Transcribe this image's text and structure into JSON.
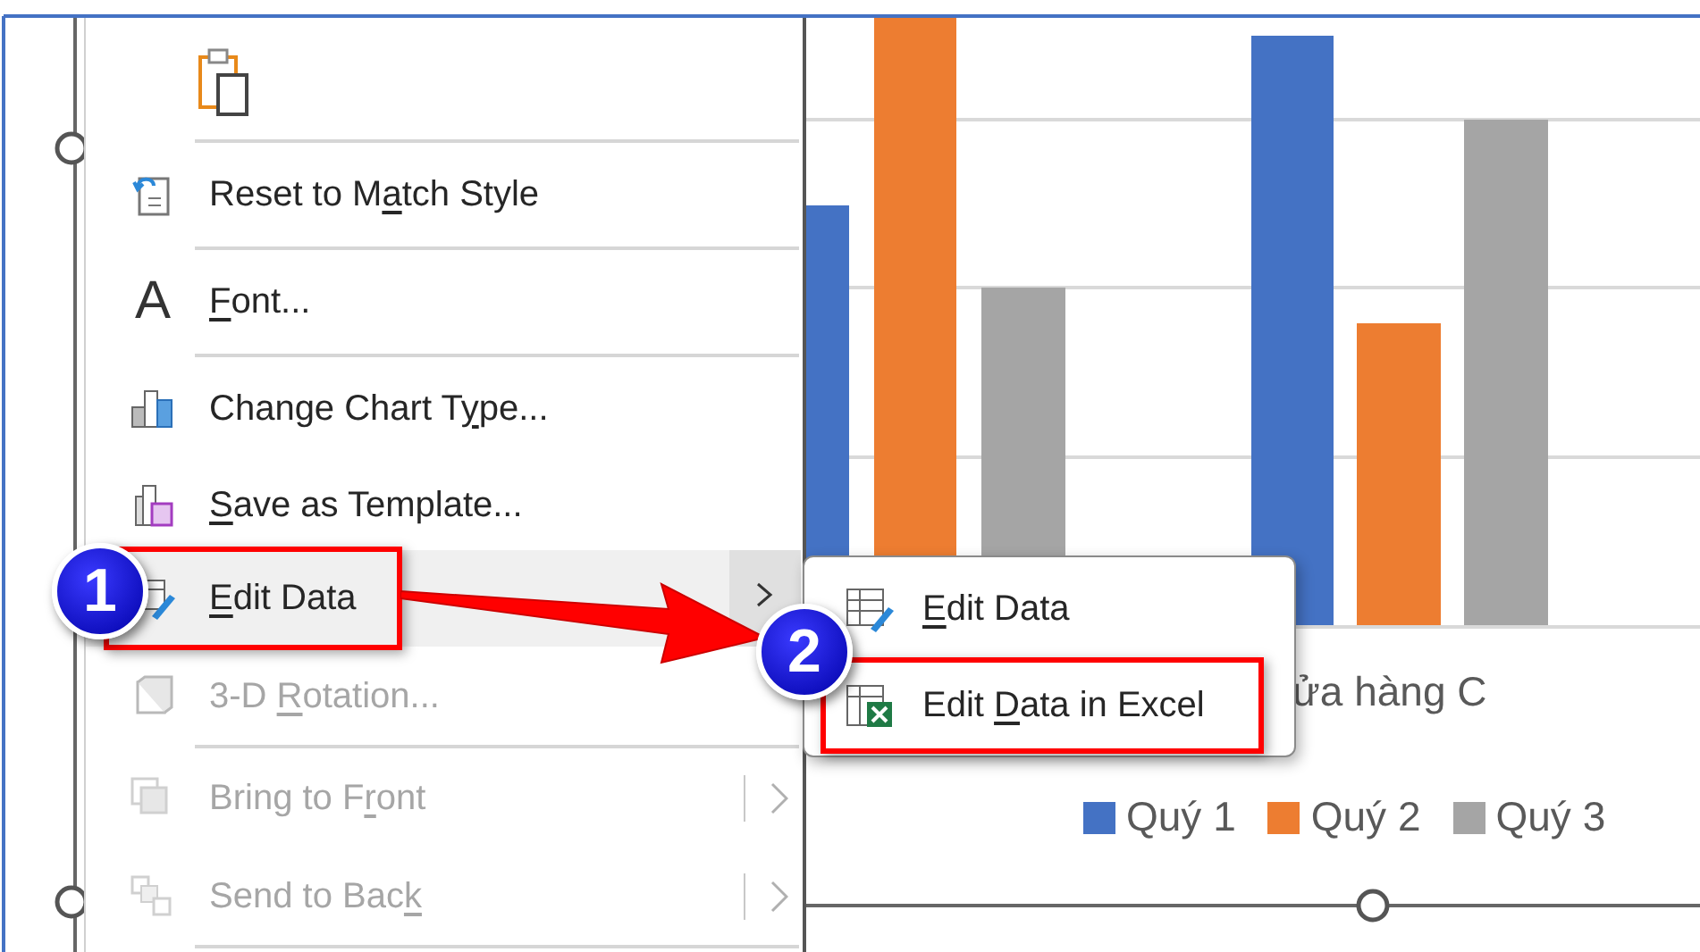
{
  "menu": {
    "items": [
      {
        "kind": "paste",
        "disabled": false,
        "selected": false,
        "submenu_arrow": false,
        "split": false,
        "separator_after": true,
        "annotated": false
      },
      {
        "kind": "command",
        "before": "Reset to M",
        "key": "a",
        "after": "tch Style",
        "disabled": false,
        "selected": false,
        "submenu_arrow": false,
        "split": false,
        "separator_after": true,
        "annotated": false
      },
      {
        "kind": "command",
        "glyph": "A",
        "key": "F",
        "after": "ont...",
        "disabled": false,
        "selected": false,
        "submenu_arrow": false,
        "split": false,
        "separator_after": true,
        "annotated": false
      },
      {
        "kind": "command",
        "before": "Change Chart T",
        "key": "y",
        "after": "pe...",
        "disabled": false,
        "selected": false,
        "submenu_arrow": false,
        "split": false,
        "separator_after": false,
        "annotated": false
      },
      {
        "kind": "command",
        "key": "S",
        "after": "ave as Template...",
        "disabled": false,
        "selected": false,
        "submenu_arrow": false,
        "split": false,
        "separator_after": false,
        "annotated": false
      },
      {
        "kind": "command",
        "key": "E",
        "after": "dit Data",
        "disabled": false,
        "selected": true,
        "submenu_arrow": true,
        "split": false,
        "separator_after": false,
        "annotated": true
      },
      {
        "kind": "command",
        "before": "3-D ",
        "key": "R",
        "after": "otation...",
        "disabled": true,
        "selected": false,
        "submenu_arrow": false,
        "split": false,
        "separator_after": true,
        "annotated": false
      },
      {
        "kind": "command",
        "before": "Bring to F",
        "key": "r",
        "after": "ont",
        "disabled": true,
        "selected": false,
        "submenu_arrow": true,
        "split": true,
        "separator_after": false,
        "annotated": false
      },
      {
        "kind": "command",
        "before": "Send to Bac",
        "key": "k",
        "disabled": true,
        "selected": false,
        "submenu_arrow": true,
        "split": true,
        "separator_after": true,
        "annotated": false
      }
    ]
  },
  "submenu": {
    "items": [
      {
        "key": "E",
        "after": "dit Data",
        "annotated": false
      },
      {
        "before": "Edit ",
        "key": "D",
        "after": "ata in Excel",
        "annotated": true
      }
    ]
  },
  "chart": {
    "category_label": "ửa hàng C",
    "legend": [
      {
        "label": "Quý 1",
        "color": "#4472c4"
      },
      {
        "label": "Quý 2",
        "color": "#ed7d31"
      },
      {
        "label": "Quý 3",
        "color": "#a5a5a5"
      }
    ]
  },
  "callouts": [
    {
      "number": "1"
    },
    {
      "number": "2"
    }
  ]
}
